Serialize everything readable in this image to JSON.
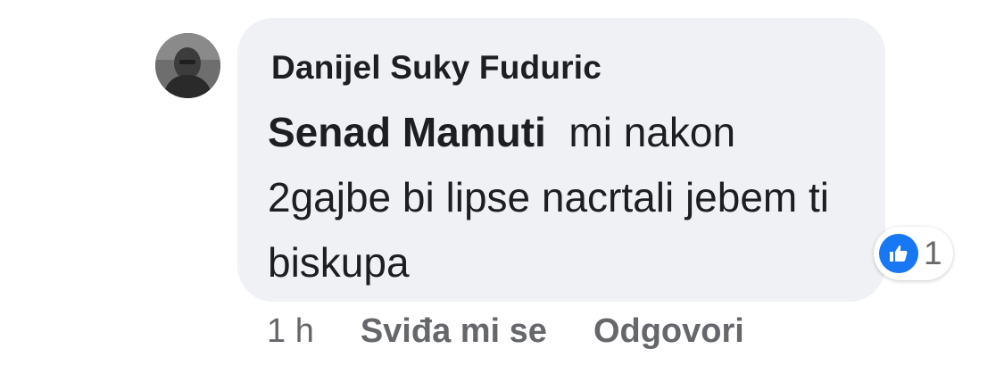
{
  "comment": {
    "author": "Danijel Suky Fuduric",
    "mention": "Senad Mamuti",
    "text_after_mention": "  mi nakon 2gajbe bi lipse nacrtali jebem ti biskupa",
    "reaction_icon": "like-icon",
    "reaction_count": "1",
    "timestamp": "1 h",
    "like_label": "Sviđa mi se",
    "reply_label": "Odgovori"
  },
  "colors": {
    "bubble": "#f0f1f4",
    "text": "#1c1e21",
    "secondary_text": "#65676b",
    "like_blue": "#1877f2"
  }
}
